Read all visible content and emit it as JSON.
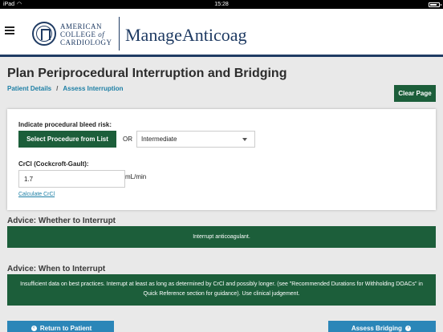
{
  "status_bar": {
    "device": "iPad",
    "time": "15:28"
  },
  "header": {
    "logo_line1": "AMERICAN",
    "logo_line2_a": "COLLEGE",
    "logo_line2_of": "of",
    "logo_line3": "CARDIOLOGY",
    "brand": "ManageAnticoag"
  },
  "page": {
    "title": "Plan Periprocedural Interruption and Bridging",
    "breadcrumb": [
      "Patient Details",
      "/",
      "Assess Interruption"
    ],
    "clear_label": "Clear Page"
  },
  "form": {
    "bleed_label": "Indicate procedural bleed risk:",
    "select_procedure_label": "Select Procedure from List",
    "or_label": "OR",
    "bleed_risk_value": "Intermediate",
    "crcl_label": "CrCl (Cockcroft-Gault):",
    "crcl_value": "1.7",
    "crcl_unit": "mL/min",
    "calc_link": "Calculate CrCl"
  },
  "advice": {
    "whether_title": "Advice: Whether to Interrupt",
    "whether_text": "Interrupt anticoagulant.",
    "when_title": "Advice: When to Interrupt",
    "when_text": "Insufficient data on best practices. Interrupt at least as long as determined by CrCl and possibly longer. (see \"Recommended Durations for Withholding DOACs\" in Quick Reference section for guidance). Use clinical judgement."
  },
  "footer": {
    "back_label": "Return to Patient",
    "next_label": "Assess Bridging"
  },
  "colors": {
    "primary_green": "#1c5e3a",
    "link_blue": "#1d7fa5",
    "button_blue": "#2b86b8",
    "navy": "#1f3b63"
  }
}
